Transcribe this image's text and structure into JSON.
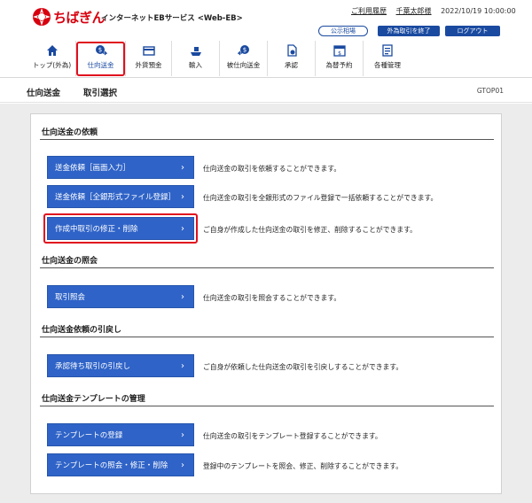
{
  "header": {
    "brand": "ちばぎん",
    "service": "インターネットEBサービス <Web-EB>",
    "help_link": "ご利用履歴",
    "user_link": "千葉太郎様",
    "timestamp": "2022/10/19 10:00:00",
    "public_rate_button": "公示相場",
    "end_fx_button": "外為取引を終了",
    "logout_button": "ログアウト",
    "accent_color": "#1a4aa0",
    "brand_color": "#d7000f"
  },
  "nav": {
    "items": [
      {
        "label": "トップ(外為)",
        "icon": "home-icon"
      },
      {
        "label": "仕向送金",
        "icon": "remit-icon",
        "active": true
      },
      {
        "label": "外貨預金",
        "icon": "deposit-icon"
      },
      {
        "label": "輸入",
        "icon": "import-icon"
      },
      {
        "label": "被仕向送金",
        "icon": "receive-icon"
      },
      {
        "label": "承認",
        "icon": "approve-icon"
      },
      {
        "label": "為替予約",
        "icon": "forward-icon"
      },
      {
        "label": "各種管理",
        "icon": "manage-icon"
      }
    ]
  },
  "titlebar": {
    "section": "仕向送金",
    "page": "取引選択",
    "code": "GTOP01"
  },
  "sections": [
    {
      "title": "仕向送金の依頼",
      "items": [
        {
          "label": "送金依頼［画面入力］",
          "desc": "仕向送金の取引を依頼することができます。"
        },
        {
          "label": "送金依頼［全銀形式ファイル登録］",
          "desc": "仕向送金の取引を全銀形式のファイル登録で一括依頼することができます。"
        },
        {
          "label": "作成中取引の修正・削除",
          "desc": "ご自身が作成した仕向送金の取引を修正、削除することができます。"
        }
      ]
    },
    {
      "title": "仕向送金の照会",
      "items": [
        {
          "label": "取引照会",
          "desc": "仕向送金の取引を照会することができます。"
        }
      ]
    },
    {
      "title": "仕向送金依頼の引戻し",
      "items": [
        {
          "label": "承認待ち取引の引戻し",
          "desc": "ご自身が依頼した仕向送金の取引を引戻しすることができます。"
        }
      ]
    },
    {
      "title": "仕向送金テンプレートの管理",
      "items": [
        {
          "label": "テンプレートの登録",
          "desc": "仕向送金の取引をテンプレート登録することができます。"
        },
        {
          "label": "テンプレートの照会・修正・削除",
          "desc": "登録中のテンプレートを照会、修正、削除することができます。"
        }
      ]
    }
  ],
  "chevron": "›"
}
